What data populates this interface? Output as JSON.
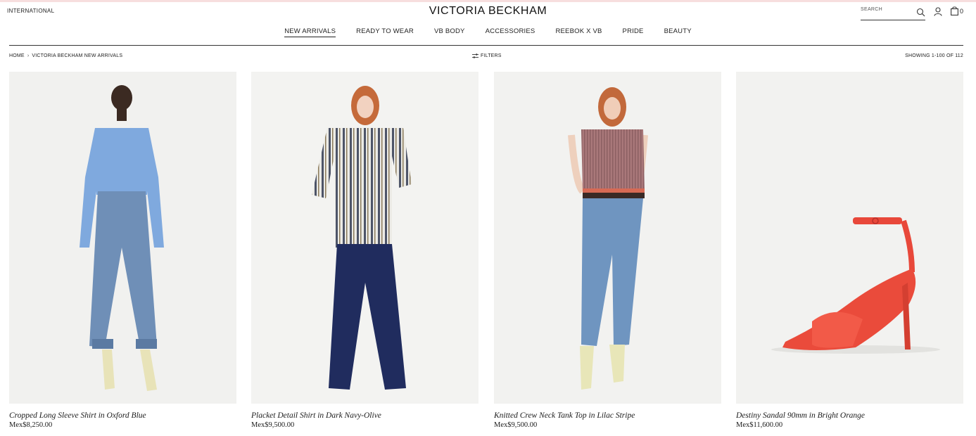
{
  "header": {
    "region": "INTERNATIONAL",
    "brand": "VICTORIA BECKHAM",
    "search_placeholder": "SEARCH",
    "bag_count": "0"
  },
  "nav": [
    {
      "label": "NEW ARRIVALS",
      "active": true
    },
    {
      "label": "READY TO WEAR"
    },
    {
      "label": "VB BODY"
    },
    {
      "label": "ACCESSORIES"
    },
    {
      "label": "REEBOK X VB"
    },
    {
      "label": "PRIDE"
    },
    {
      "label": "BEAUTY"
    }
  ],
  "breadcrumb": {
    "home": "HOME",
    "separator": "›",
    "current": "VICTORIA BECKHAM NEW ARRIVALS"
  },
  "filters_label": "FILTERS",
  "showing": "SHOWING 1-100 OF 112",
  "products": [
    {
      "name": "Cropped Long Sleeve Shirt in Oxford Blue",
      "price": "Mex$8,250.00"
    },
    {
      "name": "Placket Detail Shirt in Dark Navy-Olive",
      "price": "Mex$9,500.00"
    },
    {
      "name": "Knitted Crew Neck Tank Top in Lilac Stripe",
      "price": "Mex$9,500.00"
    },
    {
      "name": "Destiny Sandal 90mm in Bright Orange",
      "price": "Mex$11,600.00"
    }
  ],
  "colors": {
    "accent_line": "#f7dede",
    "text": "#1a1a1a",
    "image_bg": "#f2f2f0"
  }
}
